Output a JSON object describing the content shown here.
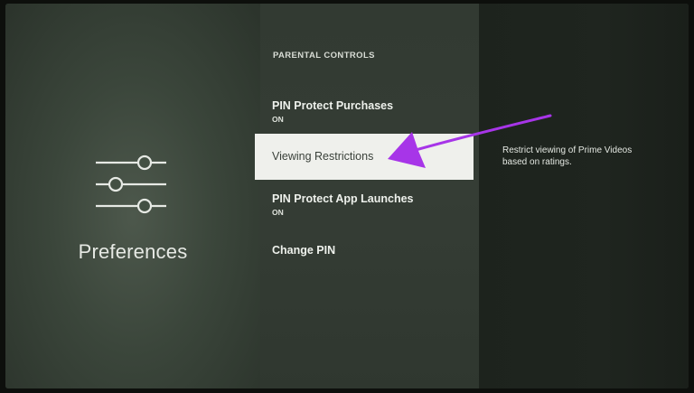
{
  "left": {
    "category_icon": "sliders-icon",
    "category_title": "Preferences"
  },
  "menu": {
    "section_header": "PARENTAL CONTROLS",
    "items": [
      {
        "label": "PIN Protect Purchases",
        "value": "ON"
      },
      {
        "label": "Viewing Restrictions",
        "value": ""
      },
      {
        "label": "PIN Protect App Launches",
        "value": "ON"
      },
      {
        "label": "Change PIN",
        "value": ""
      }
    ],
    "selected_index": 1
  },
  "description": {
    "text": "Restrict viewing of Prime Videos based on ratings."
  },
  "annotation": {
    "icon": "arrow-icon",
    "color": "#a735e8"
  },
  "colors": {
    "selected_bg": "#eff0ec",
    "background": "#2e362e"
  }
}
